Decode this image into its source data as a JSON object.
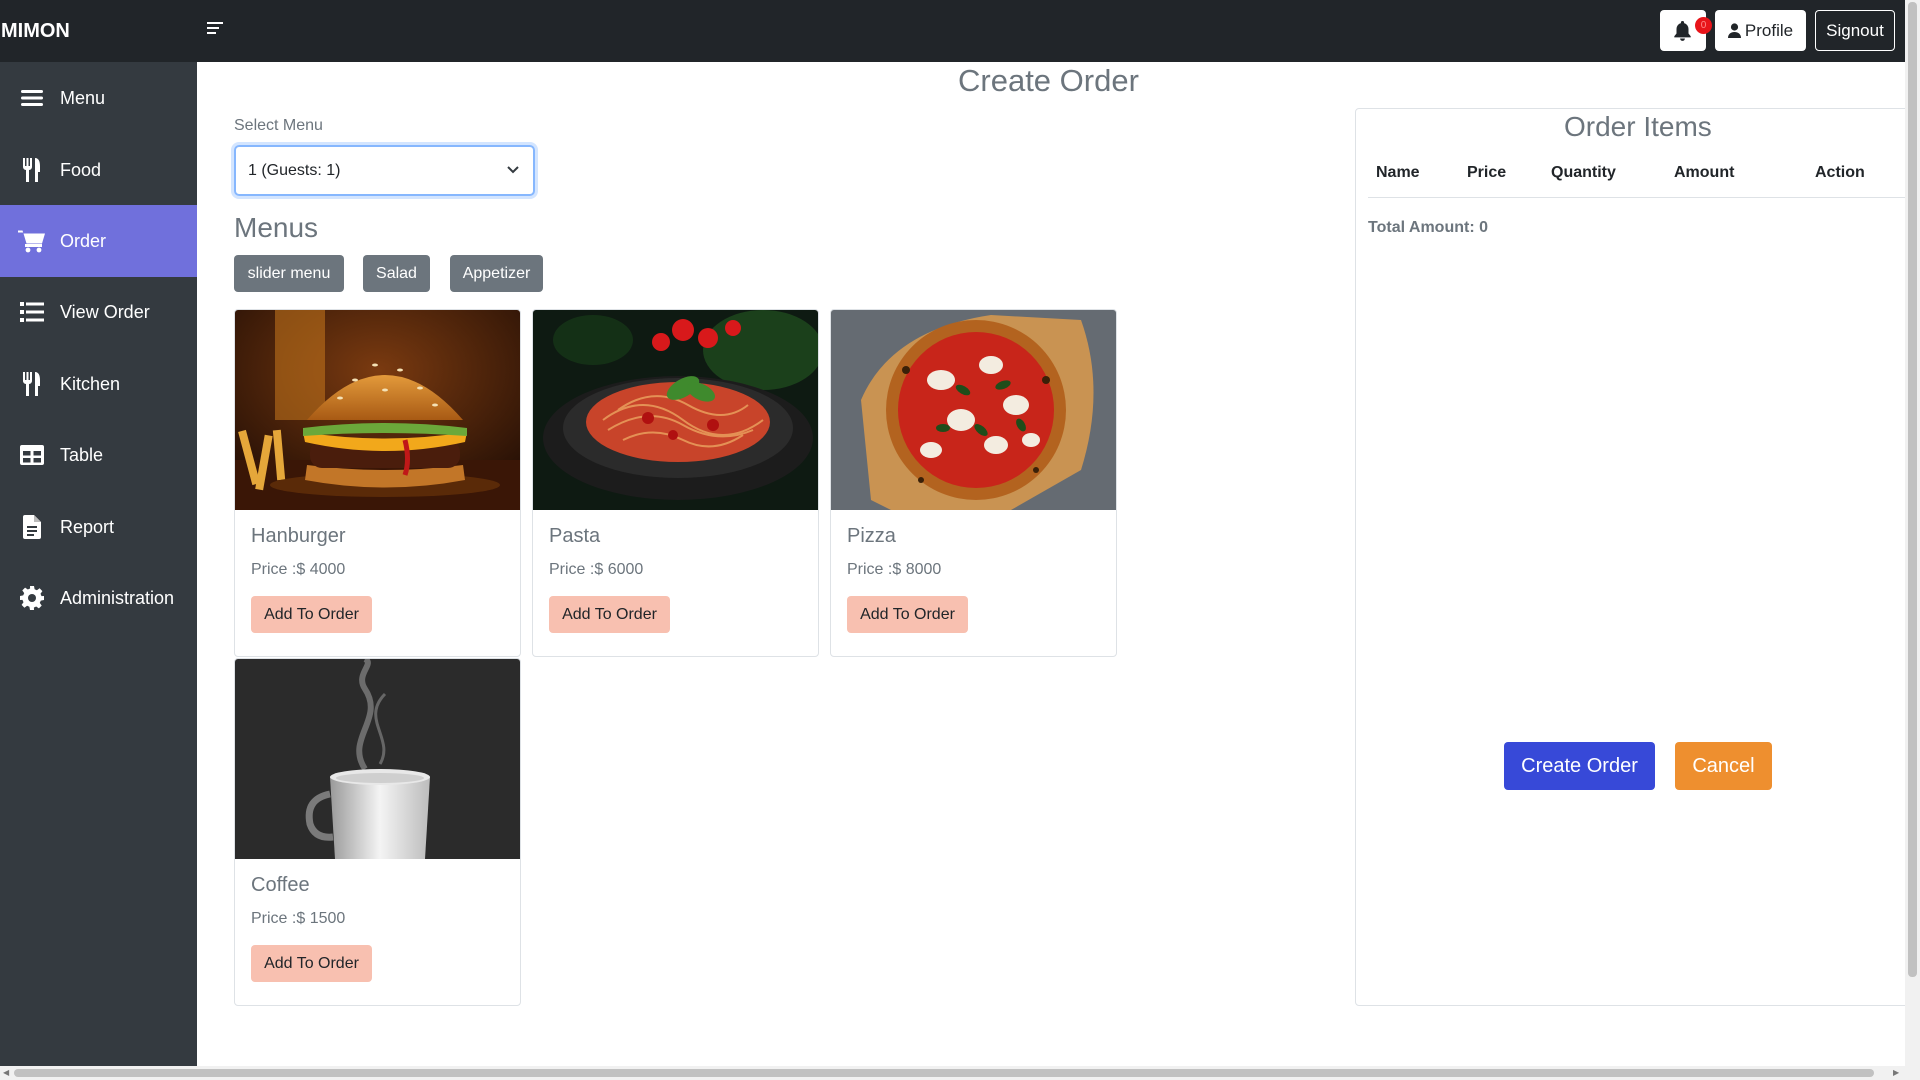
{
  "topbar": {
    "brand": "MIMON",
    "notifications_count": "0",
    "profile_label": "Profile",
    "signout_label": "Signout"
  },
  "sidebar": {
    "items": [
      {
        "label": "Menu",
        "icon": "bars-icon"
      },
      {
        "label": "Food",
        "icon": "utensils-icon"
      },
      {
        "label": "Order",
        "icon": "cart-icon",
        "active": true
      },
      {
        "label": "View Order",
        "icon": "list-icon"
      },
      {
        "label": "Kitchen",
        "icon": "utensils-icon"
      },
      {
        "label": "Table",
        "icon": "table-icon"
      },
      {
        "label": "Report",
        "icon": "file-icon"
      },
      {
        "label": "Administration",
        "icon": "gear-icon"
      }
    ]
  },
  "main": {
    "title": "Create Order",
    "select_label": "Select Menu",
    "select_value": "1 (Guests: 1)",
    "menus_title": "Menus",
    "categories": [
      "slider menu",
      "Salad",
      "Appetizer"
    ],
    "foods": [
      {
        "name": "Hanburger",
        "price": "Price :$ 4000",
        "button": "Add To Order"
      },
      {
        "name": "Pasta",
        "price": "Price :$ 6000",
        "button": "Add To Order"
      },
      {
        "name": "Pizza",
        "price": "Price :$ 8000",
        "button": "Add To Order"
      },
      {
        "name": "Coffee",
        "price": "Price :$ 1500",
        "button": "Add To Order"
      }
    ]
  },
  "order": {
    "title": "Order Items",
    "columns": [
      "Name",
      "Price",
      "Quantity",
      "Amount",
      "Action"
    ],
    "total_label": "Total Amount: 0",
    "create_label": "Create Order",
    "cancel_label": "Cancel"
  },
  "colors": {
    "topbar": "#212529",
    "sidebar": "#343a40",
    "active_nav": "#7070dc",
    "add_button": "#f8c0b0",
    "create_button": "#3749d8",
    "cancel_button": "#ee8f2f"
  }
}
